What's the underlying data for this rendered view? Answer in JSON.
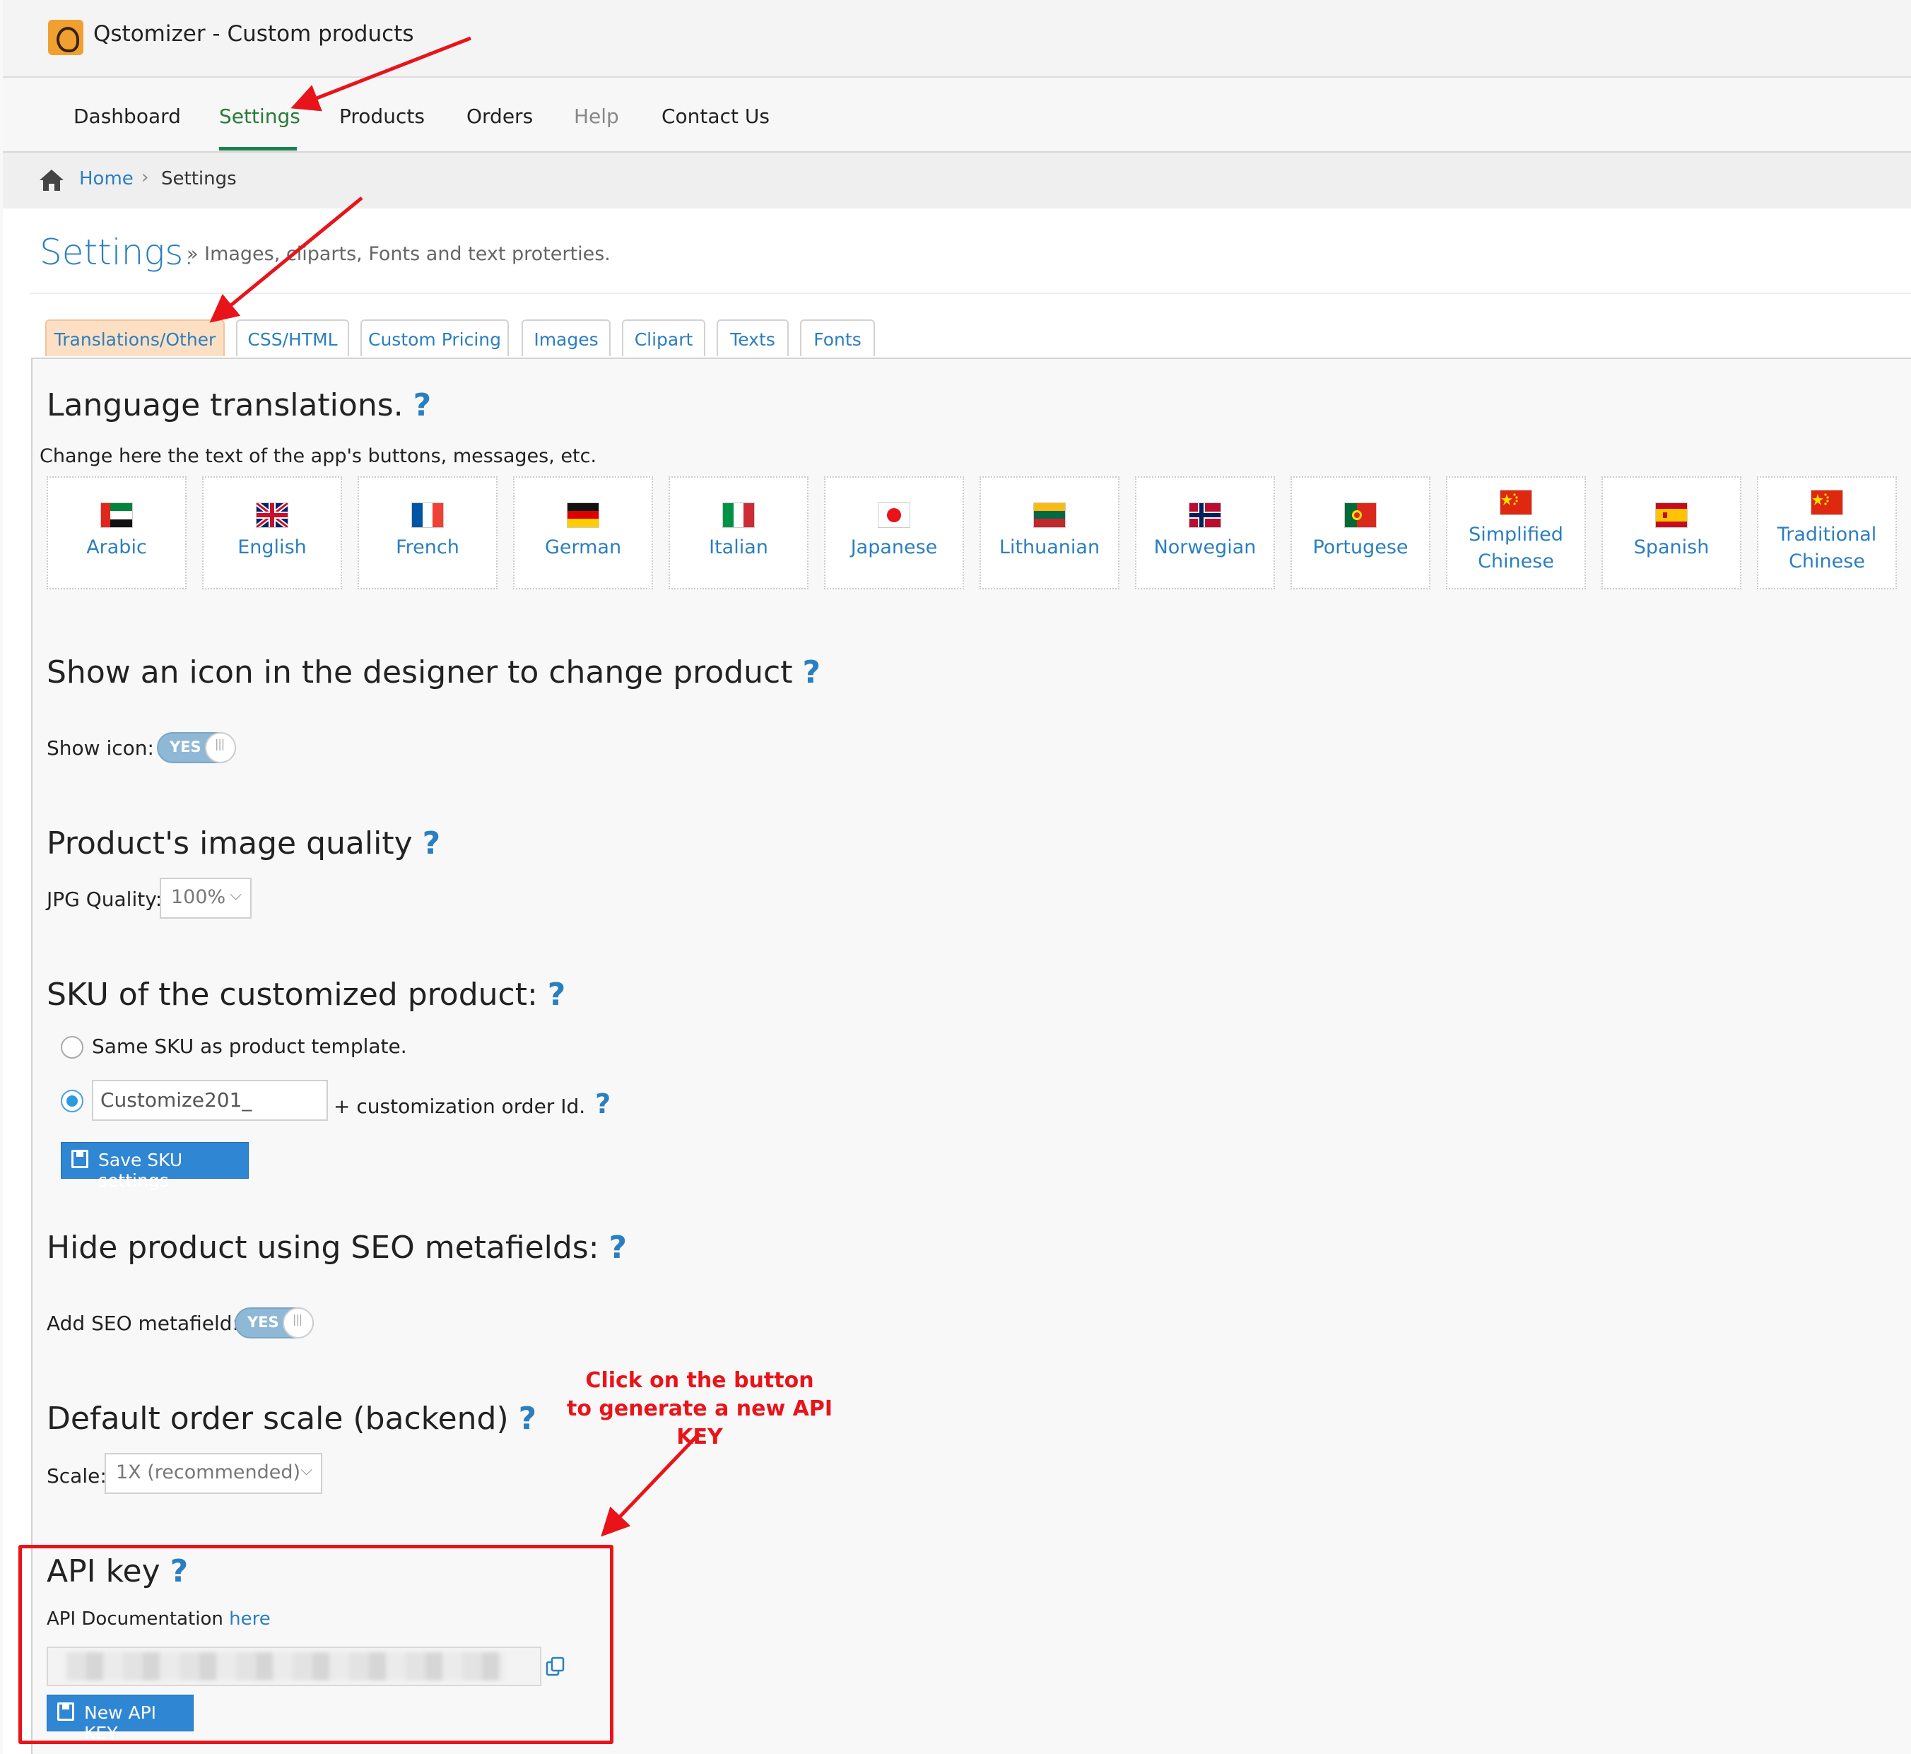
{
  "app": {
    "title": "Qstomizer - Custom products"
  },
  "nav": {
    "items": [
      {
        "label": "Dashboard"
      },
      {
        "label": "Settings"
      },
      {
        "label": "Products"
      },
      {
        "label": "Orders"
      },
      {
        "label": "Help"
      },
      {
        "label": "Contact Us"
      }
    ]
  },
  "breadcrumb": {
    "home": "Home",
    "separator": "›",
    "current": "Settings"
  },
  "page": {
    "title": "Settings.",
    "subtitle": "» Images, cliparts, Fonts and text proterties."
  },
  "tabs": [
    {
      "label": "Translations/Other"
    },
    {
      "label": "CSS/HTML"
    },
    {
      "label": "Custom Pricing"
    },
    {
      "label": "Images"
    },
    {
      "label": "Clipart"
    },
    {
      "label": "Texts"
    },
    {
      "label": "Fonts"
    }
  ],
  "help_icon": "?",
  "language": {
    "title": "Language translations.",
    "description": "Change here the text of the app's buttons, messages, etc.",
    "items": [
      {
        "line1": "Arabic",
        "line2": "",
        "flag": "ae"
      },
      {
        "line1": "English",
        "line2": "",
        "flag": "gb"
      },
      {
        "line1": "French",
        "line2": "",
        "flag": "fr"
      },
      {
        "line1": "German",
        "line2": "",
        "flag": "de"
      },
      {
        "line1": "Italian",
        "line2": "",
        "flag": "it"
      },
      {
        "line1": "Japanese",
        "line2": "",
        "flag": "jp"
      },
      {
        "line1": "Lithuanian",
        "line2": "",
        "flag": "lt"
      },
      {
        "line1": "Norwegian",
        "line2": "",
        "flag": "no"
      },
      {
        "line1": "Portugese",
        "line2": "",
        "flag": "pt"
      },
      {
        "line1": "Simplified",
        "line2": "Chinese",
        "flag": "cn"
      },
      {
        "line1": "Spanish",
        "line2": "",
        "flag": "es"
      },
      {
        "line1": "Traditional",
        "line2": "Chinese",
        "flag": "cn"
      }
    ]
  },
  "change_product": {
    "title": "Show an icon in the designer to change product",
    "label": "Show icon:",
    "toggle": "YES"
  },
  "image_quality": {
    "title": "Product's image quality",
    "label": "JPG Quality:",
    "value": "100%"
  },
  "sku": {
    "title": "SKU of the customized product:",
    "option_same": "Same SKU as product template.",
    "prefix_value": "Customize201_",
    "suffix": "+ customization order Id.",
    "save_button": "Save SKU settings"
  },
  "seo": {
    "title": "Hide product using SEO metafields:",
    "label": "Add SEO metafield:",
    "toggle": "YES"
  },
  "scale": {
    "title": "Default order scale (backend)",
    "label": "Scale:",
    "value": "1X (recommended)"
  },
  "api": {
    "title": "API key",
    "doc_text": "API Documentation",
    "doc_link": "here",
    "button": "New API KEY"
  },
  "annotation": {
    "line1": "Click on the button",
    "line2": "to generate a new API KEY"
  },
  "colors": {
    "accent": "#2b7fc0",
    "nav_active": "#1e8050",
    "annotation": "#e8141a",
    "tab_active_bg": "#fde0c4",
    "button": "#2f86d3"
  }
}
